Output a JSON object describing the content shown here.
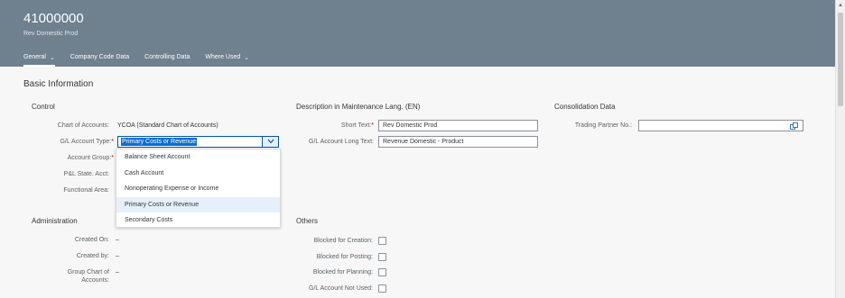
{
  "header": {
    "title": "41000000",
    "subtitle": "Rev Domestic Prod",
    "tabs": [
      {
        "label": "General"
      },
      {
        "label": "Company Code Data"
      },
      {
        "label": "Controlling Data"
      },
      {
        "label": "Where Used"
      }
    ]
  },
  "basic_information": {
    "title": "Basic Information",
    "control": {
      "title": "Control",
      "chart_of_accounts_label": "Chart of Accounts:",
      "chart_of_accounts_value": "YCOA (Standard Chart of Accounts)",
      "gl_account_type_label": "G/L Account Type:",
      "gl_account_type_value": "Primary Costs or Revenue",
      "account_group_label": "Account Group:",
      "pl_statement_label": "P&L State. Acct:",
      "functional_area_label": "Functional Area:"
    },
    "description": {
      "title": "Description in Maintenance Lang. (EN)",
      "short_text_label": "Short Text:",
      "short_text_value": "Rev Domestic Prod",
      "long_text_label": "G/L Account Long Text:",
      "long_text_value": "Revenue Domestic - Product"
    },
    "consolidation": {
      "title": "Consolidation Data",
      "trading_partner_label": "Trading Partner No.:",
      "trading_partner_value": ""
    },
    "administration": {
      "title": "Administration",
      "created_on_label": "Created On:",
      "created_on_value": "–",
      "created_by_label": "Created by:",
      "created_by_value": "–",
      "group_chart_label_1": "Group Chart of",
      "group_chart_label_2": "Accounts:",
      "group_chart_value": "–"
    },
    "others": {
      "title": "Others",
      "blocked_creation_label": "Blocked for Creation:",
      "blocked_posting_label": "Blocked for Posting:",
      "blocked_planning_label": "Blocked for Planning:",
      "not_used_label": "G/L Account Not Used:"
    }
  },
  "dropdown": {
    "options": [
      {
        "label": "Balance Sheet Account"
      },
      {
        "label": "Cash Account"
      },
      {
        "label": "Nonoperating Expense or Income"
      },
      {
        "label": "Primary Costs or Revenue"
      },
      {
        "label": "Secondary Costs"
      }
    ]
  }
}
